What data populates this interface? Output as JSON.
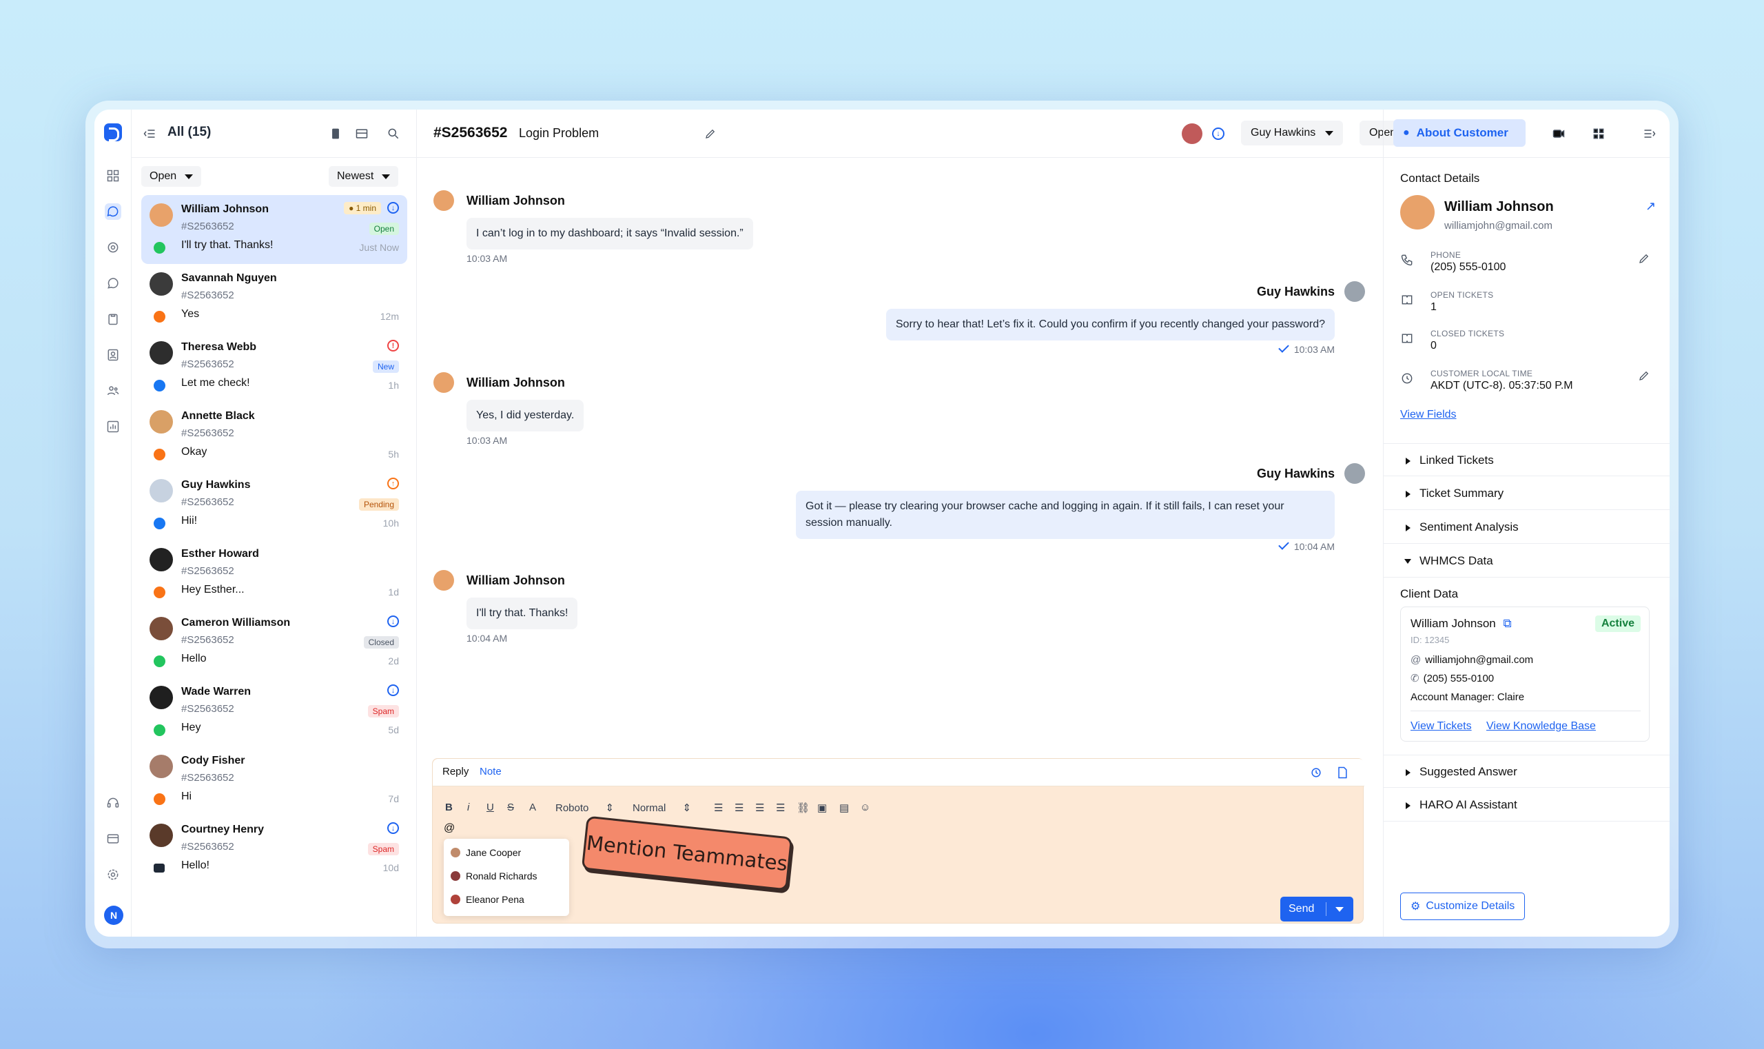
{
  "list": {
    "title": "All (15)",
    "status_filter": "Open",
    "sort": "Newest",
    "conversations": [
      {
        "name": "William Johnson",
        "id": "#S2563652",
        "message": "I'll try that. Thanks!",
        "time": "Just Now",
        "badge": "Open",
        "timer": "1 min",
        "channel": "whatsapp"
      },
      {
        "name": "Savannah Nguyen",
        "id": "#S2563652",
        "message": "Yes",
        "time": "12m",
        "badge": "",
        "channel": "chat"
      },
      {
        "name": "Theresa Webb",
        "id": "#S2563652",
        "message": "Let me check!",
        "time": "1h",
        "badge": "New",
        "channel": "facebook"
      },
      {
        "name": "Annette Black",
        "id": "#S2563652",
        "message": "Okay",
        "time": "5h",
        "badge": "",
        "channel": "chat"
      },
      {
        "name": "Guy Hawkins",
        "id": "#S2563652",
        "message": "Hii!",
        "time": "10h",
        "badge": "Pending",
        "channel": "facebook"
      },
      {
        "name": "Esther Howard",
        "id": "#S2563652",
        "message": "Hey Esther...",
        "time": "1d",
        "badge": "",
        "channel": "chat"
      },
      {
        "name": "Cameron Williamson",
        "id": "#S2563652",
        "message": "Hello",
        "time": "2d",
        "badge": "Closed",
        "channel": "whatsapp"
      },
      {
        "name": "Wade Warren",
        "id": "#S2563652",
        "message": "Hey",
        "time": "5d",
        "badge": "Spam",
        "channel": "whatsapp"
      },
      {
        "name": "Cody Fisher",
        "id": "#S2563652",
        "message": "Hi",
        "time": "7d",
        "badge": "",
        "channel": "chat"
      },
      {
        "name": "Courtney Henry",
        "id": "#S2563652",
        "message": "Hello!",
        "time": "10d",
        "badge": "Spam",
        "channel": "email"
      }
    ]
  },
  "rail": {
    "avatar_initial": "N"
  },
  "chat": {
    "ticket_id": "#S2563652",
    "subject": "Login Problem",
    "assignee": "Guy Hawkins",
    "status": "Open",
    "messages": [
      {
        "author": "William Johnson",
        "text": "I can’t log in to my dashboard; it says “Invalid session.”",
        "time": "10:03 AM"
      },
      {
        "author": "Guy Hawkins",
        "text": "Sorry to hear that! Let’s fix it. Could you confirm if you recently changed your password?",
        "time": "10:03 AM"
      },
      {
        "author": "William Johnson",
        "text": "Yes, I did yesterday.",
        "time": "10:03 AM"
      },
      {
        "author": "Guy Hawkins",
        "text_line1": "Got it — please try clearing your browser cache and logging in again. If it still fails, I can reset your",
        "text_line2": "session manually.",
        "time": "10:04 AM"
      },
      {
        "author": "William Johnson",
        "text": "I'll try that. Thanks!",
        "time": "10:04 AM"
      }
    ],
    "composer": {
      "tab_reply": "Reply",
      "tab_note": "Note",
      "font": "Roboto",
      "size": "Normal",
      "typed": "@",
      "send": "Send",
      "mentions": [
        "Jane Cooper",
        "Ronald Richards",
        "Eleanor Pena"
      ]
    },
    "sticker": "Mention Teammates"
  },
  "side": {
    "tab": "About Customer",
    "section": "Contact Details",
    "name": "William Johnson",
    "email": "williamjohn@gmail.com",
    "phone_label": "PHONE",
    "phone": "(205) 555-0100",
    "open_label": "OPEN TICKETS",
    "open": "1",
    "closed_label": "CLOSED TICKETS",
    "closed": "0",
    "local_label": "CUSTOMER LOCAL TIME",
    "local": "AKDT (UTC-8). 05:37:50 P.M",
    "view_fields": "View Fields",
    "accordions": [
      "Linked Tickets",
      "Ticket Summary",
      "Sentiment Analysis",
      "WHMCS Data"
    ],
    "client_data": "Client Data",
    "client": {
      "name": "William Johnson",
      "id": "ID: 12345",
      "status": "Active",
      "email": "williamjohn@gmail.com",
      "phone": "(205) 555-0100",
      "manager": "Account Manager: Claire",
      "view_tickets": "View Tickets",
      "view_kb": "View Knowledge Base"
    },
    "accordions2": [
      "Suggested Answer",
      "HARO AI Assistant"
    ],
    "customize": "Customize Details"
  },
  "colors": {
    "accent": "#1e63f0",
    "selected_row": "#dbe7ff",
    "composer_bg": "#fde9d6",
    "sticker": "#f4896b"
  }
}
